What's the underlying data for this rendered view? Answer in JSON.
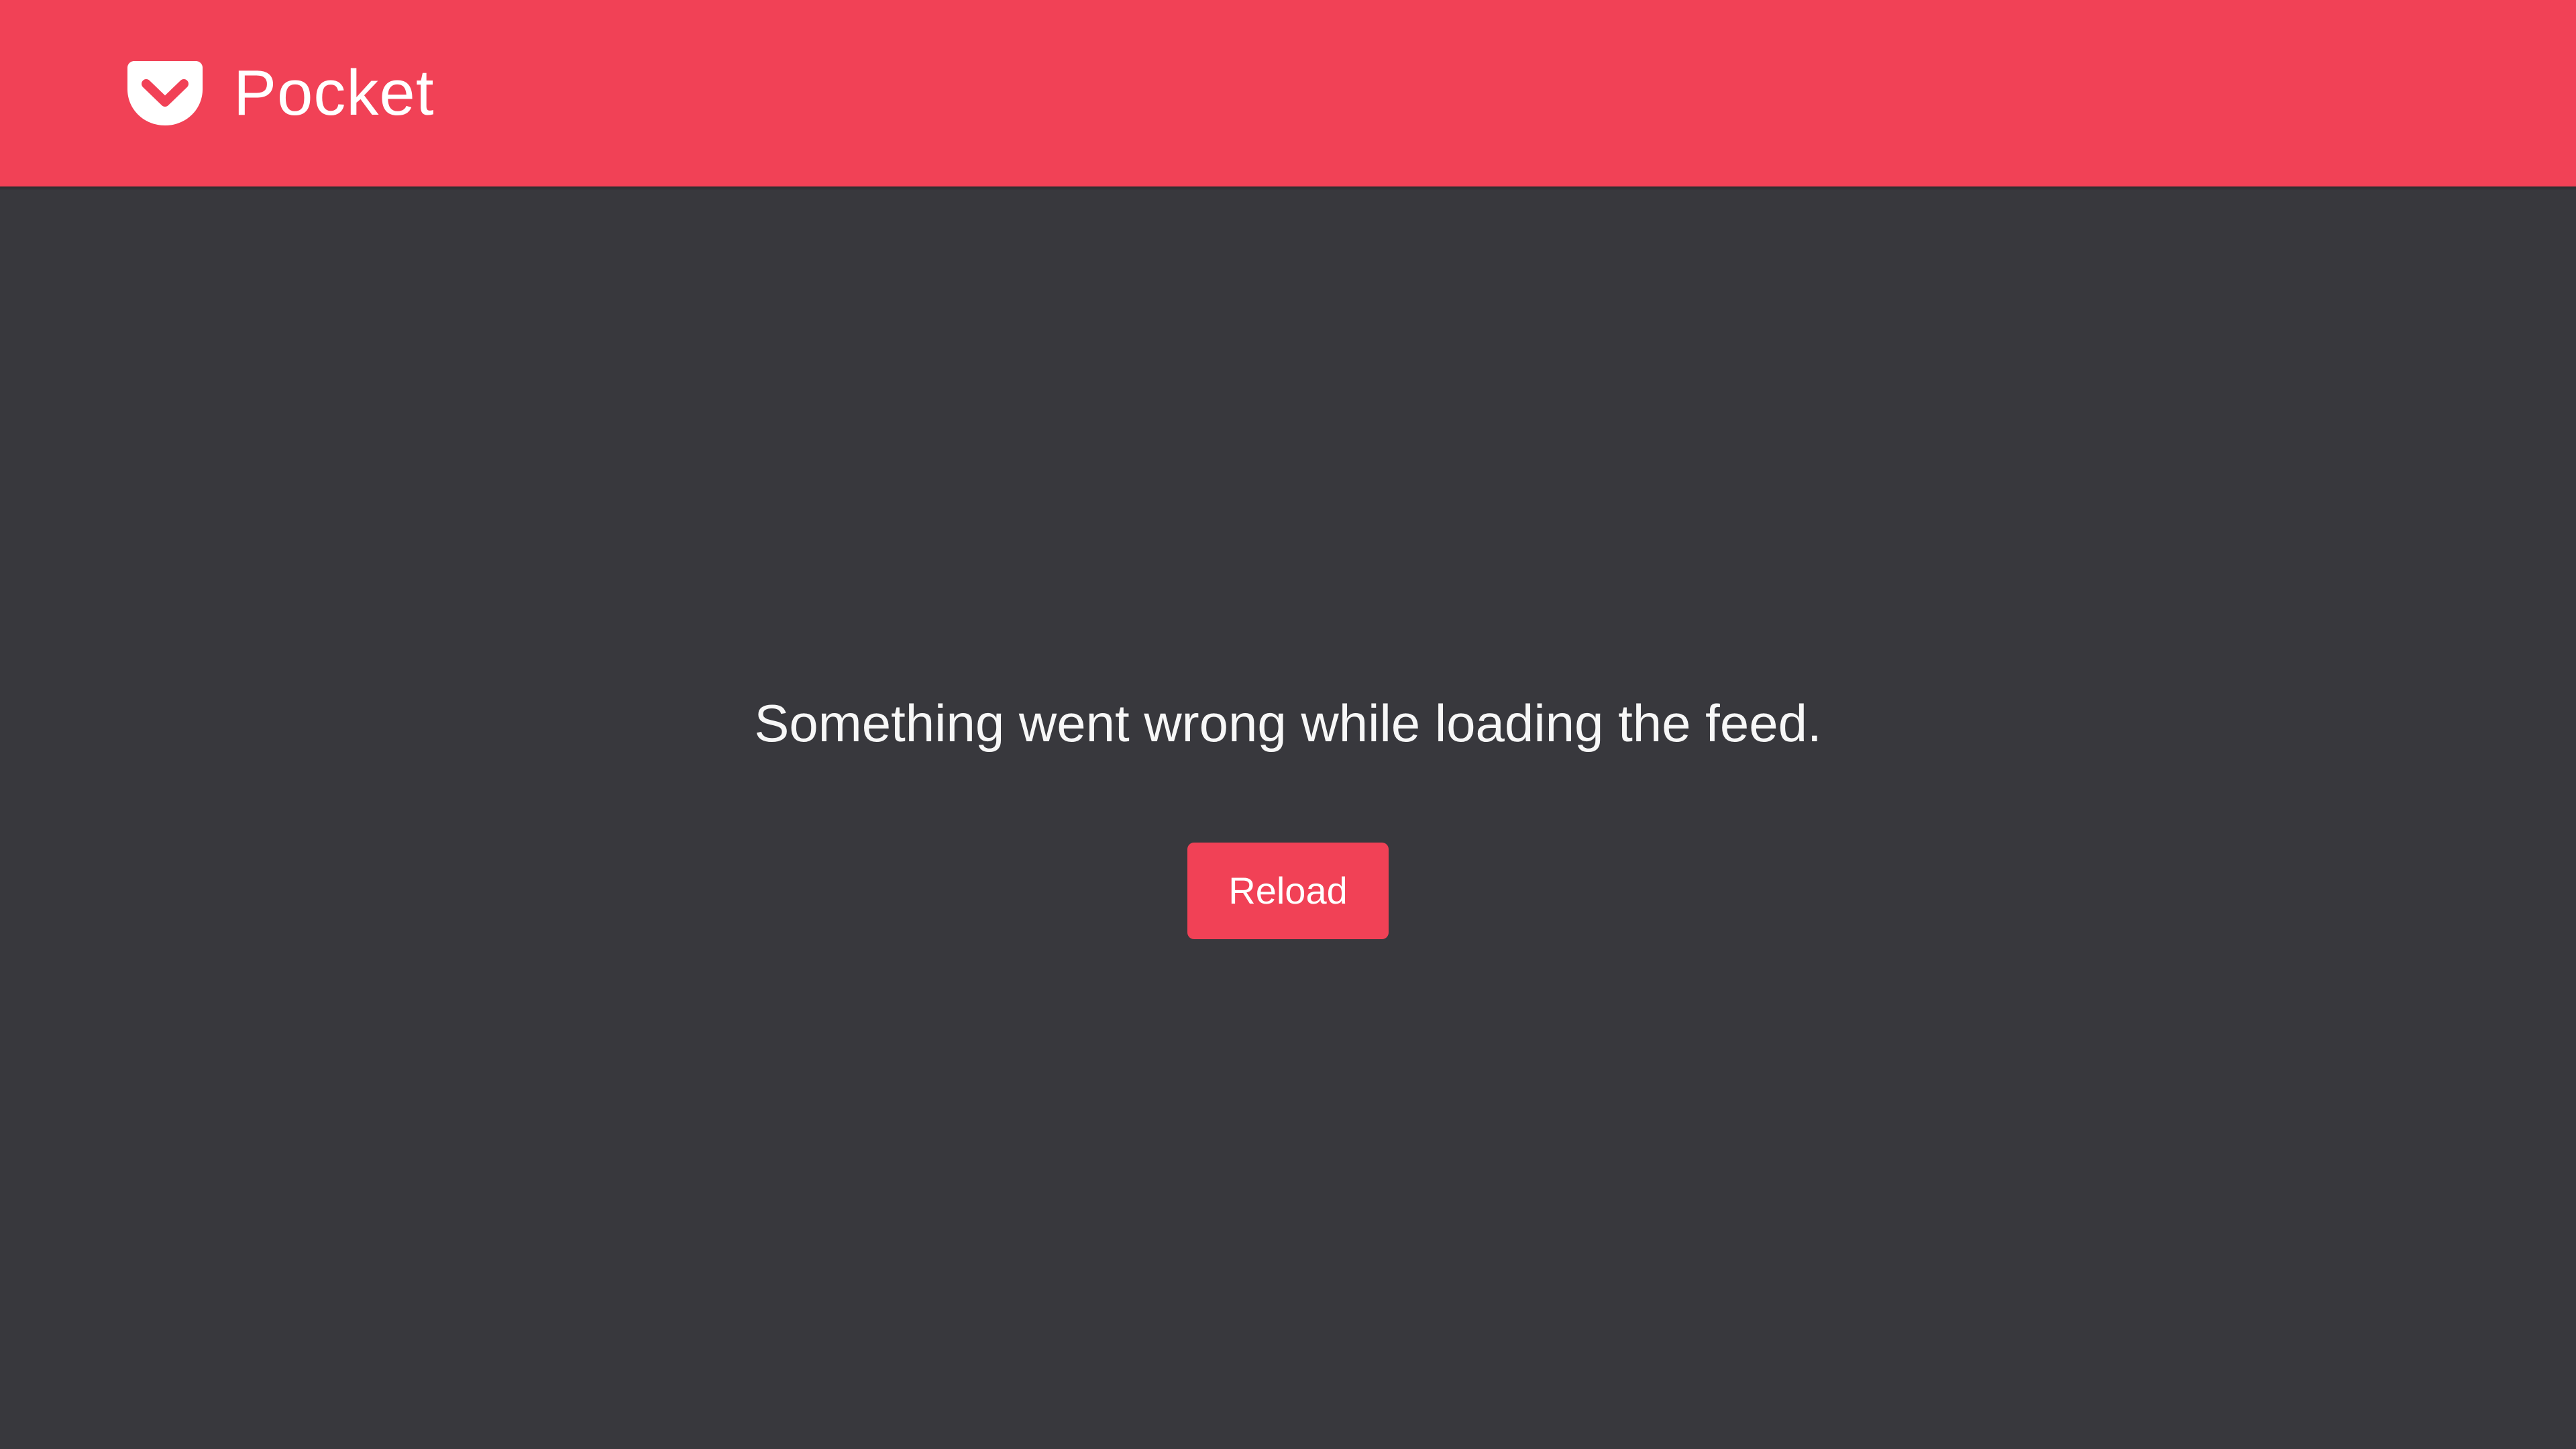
{
  "header": {
    "app_name": "Pocket",
    "logo_icon": "pocket-logo-icon",
    "background_color": "#f14156"
  },
  "main": {
    "background_color": "#38383d",
    "error_message": "Something went wrong while loading the feed.",
    "reload_label": "Reload",
    "button_color": "#f14156"
  }
}
